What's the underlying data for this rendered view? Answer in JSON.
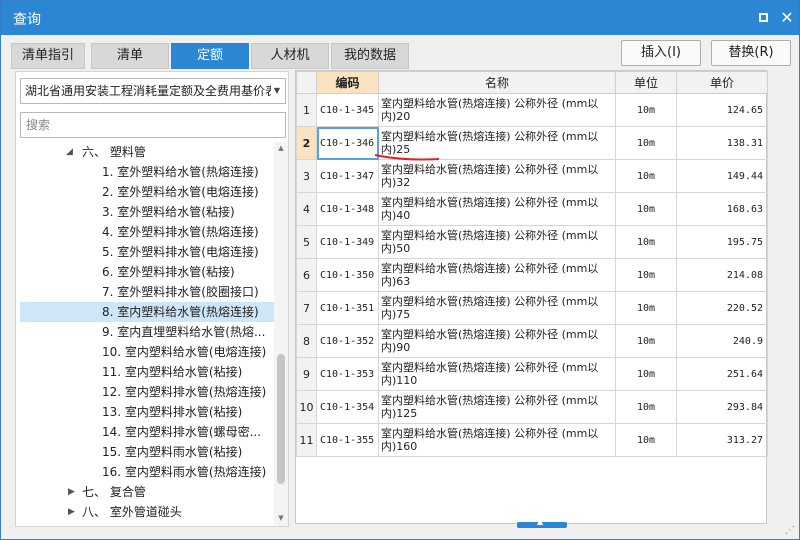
{
  "window": {
    "title": "查询"
  },
  "tabs": [
    {
      "label": "清单指引"
    },
    {
      "label": "清单"
    },
    {
      "label": "定额"
    },
    {
      "label": "人材机"
    },
    {
      "label": "我的数据"
    }
  ],
  "actions": {
    "insert": "插入(I)",
    "replace": "替换(R)"
  },
  "library": {
    "selected": "湖北省通用安装工程消耗量定额及全费用基价表"
  },
  "search": {
    "placeholder": "搜索",
    "value": ""
  },
  "tree": [
    {
      "label": "六、 塑料管",
      "level": 1,
      "expanded": true
    },
    {
      "label": "1. 室外塑料给水管(热熔连接)",
      "level": 2
    },
    {
      "label": "2. 室外塑料给水管(电熔连接)",
      "level": 2
    },
    {
      "label": "3. 室外塑料给水管(粘接)",
      "level": 2
    },
    {
      "label": "4. 室外塑料排水管(热熔连接)",
      "level": 2
    },
    {
      "label": "5. 室外塑料排水管(电熔连接)",
      "level": 2
    },
    {
      "label": "6. 室外塑料排水管(粘接)",
      "level": 2
    },
    {
      "label": "7. 室外塑料排水管(胶圈接口)",
      "level": 2
    },
    {
      "label": "8. 室内塑料给水管(热熔连接)",
      "level": 2,
      "selected": true
    },
    {
      "label": "9. 室内直埋塑料给水管(热熔...",
      "level": 2
    },
    {
      "label": "10. 室内塑料给水管(电熔连接)",
      "level": 2
    },
    {
      "label": "11. 室内塑料给水管(粘接)",
      "level": 2
    },
    {
      "label": "12. 室内塑料排水管(热熔连接)",
      "level": 2
    },
    {
      "label": "13. 室内塑料排水管(粘接)",
      "level": 2
    },
    {
      "label": "14. 室内塑料排水管(螺母密...",
      "level": 2
    },
    {
      "label": "15. 室内塑料雨水管(粘接)",
      "level": 2
    },
    {
      "label": "16. 室内塑料雨水管(热熔连接)",
      "level": 2
    },
    {
      "label": "七、 复合管",
      "level": 1,
      "expanded": false
    },
    {
      "label": "八、 室外管道碰头",
      "level": 1,
      "expanded": false
    }
  ],
  "grid": {
    "headers": {
      "code": "编码",
      "name": "名称",
      "unit": "单位",
      "price": "单价"
    },
    "rows": [
      {
        "no": "1",
        "code": "C10-1-345",
        "name": "室内塑料给水管(热熔连接) 公称外径 (mm以内)20",
        "unit": "10m",
        "price": "124.65"
      },
      {
        "no": "2",
        "code": "C10-1-346",
        "name": "室内塑料给水管(热熔连接) 公称外径 (mm以内)25",
        "unit": "10m",
        "price": "138.31"
      },
      {
        "no": "3",
        "code": "C10-1-347",
        "name": "室内塑料给水管(热熔连接) 公称外径 (mm以内)32",
        "unit": "10m",
        "price": "149.44"
      },
      {
        "no": "4",
        "code": "C10-1-348",
        "name": "室内塑料给水管(热熔连接) 公称外径 (mm以内)40",
        "unit": "10m",
        "price": "168.63"
      },
      {
        "no": "5",
        "code": "C10-1-349",
        "name": "室内塑料给水管(热熔连接) 公称外径 (mm以内)50",
        "unit": "10m",
        "price": "195.75"
      },
      {
        "no": "6",
        "code": "C10-1-350",
        "name": "室内塑料给水管(热熔连接) 公称外径 (mm以内)63",
        "unit": "10m",
        "price": "214.08"
      },
      {
        "no": "7",
        "code": "C10-1-351",
        "name": "室内塑料给水管(热熔连接) 公称外径 (mm以内)75",
        "unit": "10m",
        "price": "220.52"
      },
      {
        "no": "8",
        "code": "C10-1-352",
        "name": "室内塑料给水管(热熔连接) 公称外径 (mm以内)90",
        "unit": "10m",
        "price": "240.9"
      },
      {
        "no": "9",
        "code": "C10-1-353",
        "name": "室内塑料给水管(热熔连接) 公称外径 (mm以内)110",
        "unit": "10m",
        "price": "251.64"
      },
      {
        "no": "10",
        "code": "C10-1-354",
        "name": "室内塑料给水管(热熔连接) 公称外径 (mm以内)125",
        "unit": "10m",
        "price": "293.84"
      },
      {
        "no": "11",
        "code": "C10-1-355",
        "name": "室内塑料给水管(热熔连接) 公称外径 (mm以内)160",
        "unit": "10m",
        "price": "313.27"
      }
    ],
    "selected_row": 2
  },
  "colors": {
    "accent": "#2b87d3",
    "selection": "#cfe5f8",
    "header_selected": "#fbe3c2",
    "annotation": "#d9262a"
  }
}
